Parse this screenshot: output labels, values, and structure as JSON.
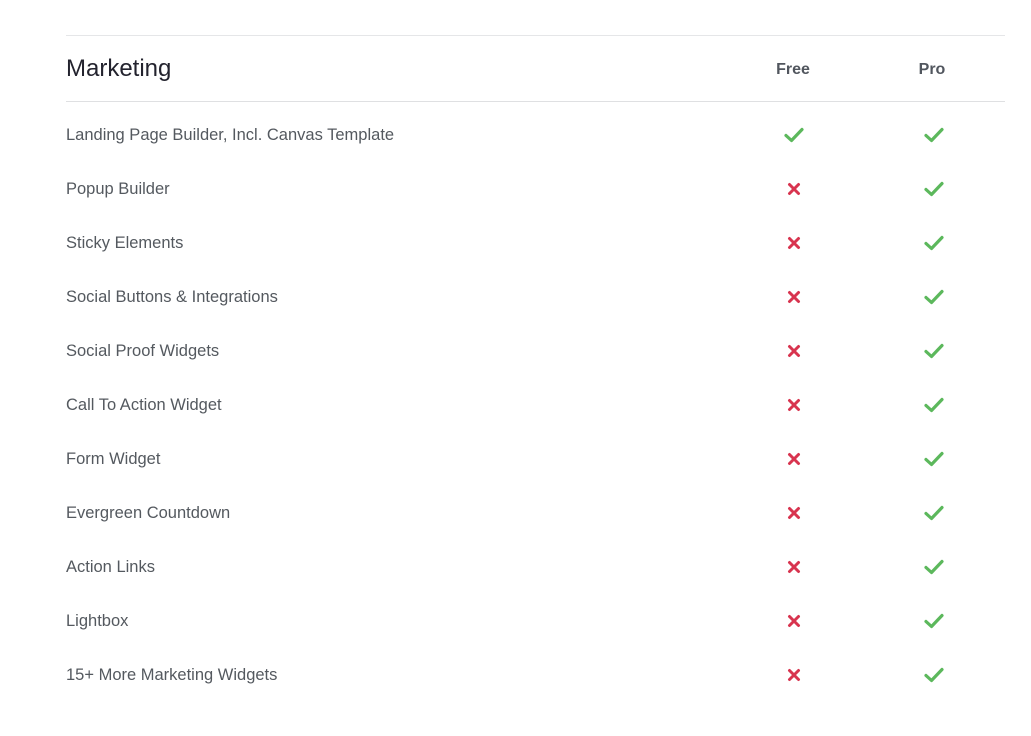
{
  "section": {
    "title": "Marketing",
    "columns": [
      "Free",
      "Pro"
    ]
  },
  "colors": {
    "check": "#5cb85c",
    "cross": "#d8344f"
  },
  "features": [
    {
      "label": "Landing Page Builder, Incl. Canvas Template",
      "free": true,
      "pro": true
    },
    {
      "label": "Popup Builder",
      "free": false,
      "pro": true
    },
    {
      "label": "Sticky Elements",
      "free": false,
      "pro": true
    },
    {
      "label": "Social Buttons & Integrations",
      "free": false,
      "pro": true
    },
    {
      "label": "Social Proof Widgets",
      "free": false,
      "pro": true
    },
    {
      "label": "Call To Action Widget",
      "free": false,
      "pro": true
    },
    {
      "label": "Form Widget",
      "free": false,
      "pro": true
    },
    {
      "label": "Evergreen Countdown",
      "free": false,
      "pro": true
    },
    {
      "label": "Action Links",
      "free": false,
      "pro": true
    },
    {
      "label": "Lightbox",
      "free": false,
      "pro": true
    },
    {
      "label": "15+ More Marketing Widgets",
      "free": false,
      "pro": true
    }
  ]
}
